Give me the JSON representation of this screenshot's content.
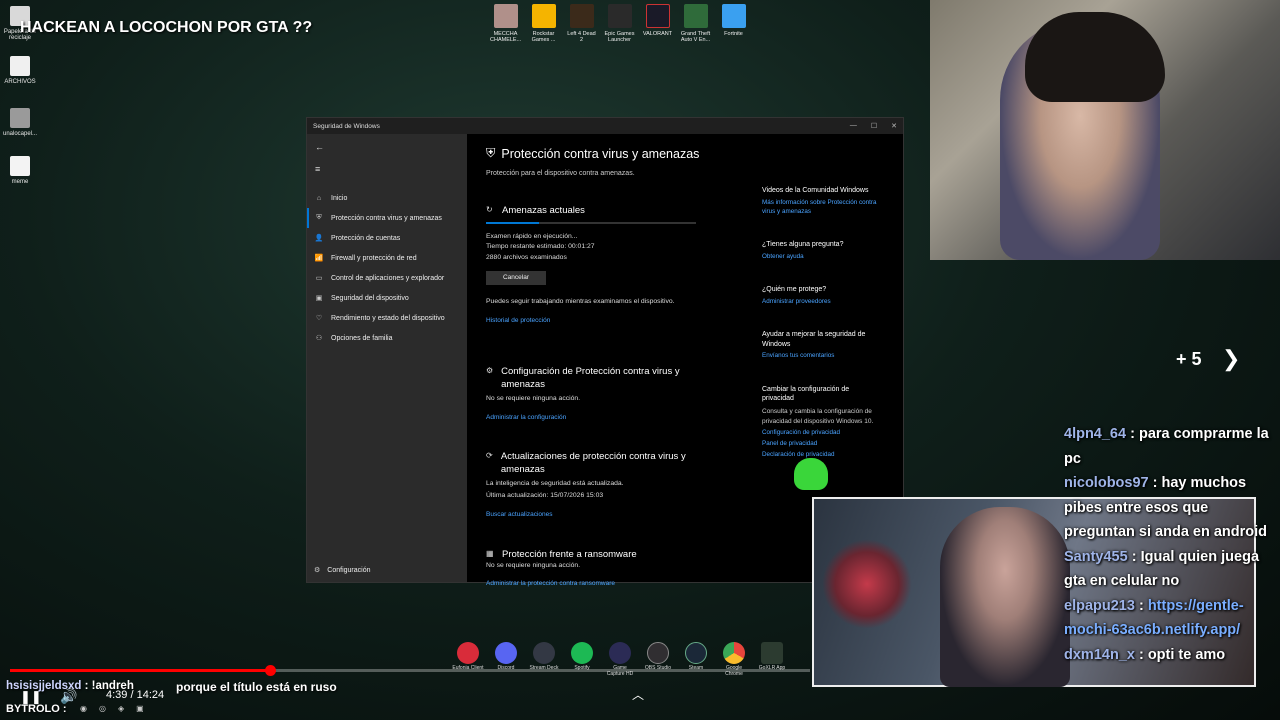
{
  "overlay": {
    "title": "HACKEAN A LOCOCHON POR GTA ??"
  },
  "desktop_icons": [
    {
      "label": "Papelera de reciclaje"
    },
    {
      "label": "ARCHIVOS"
    },
    {
      "label": "unalocapel..."
    },
    {
      "label": "meme"
    }
  ],
  "top_apps": [
    {
      "label": "MECCHA CHAMELE...",
      "color": "#b0908a"
    },
    {
      "label": "Rockstar Games ...",
      "color": "#f5b400"
    },
    {
      "label": "Left 4 Dead 2",
      "color": "#3b2a1a"
    },
    {
      "label": "Epic Games Launcher",
      "color": "#2a2a2a"
    },
    {
      "label": "VALORANT",
      "color": "#1a1a28"
    },
    {
      "label": "Grand Theft Auto V En...",
      "color": "#2f6b3a"
    },
    {
      "label": "Fortnite",
      "color": "#3aa0f0"
    }
  ],
  "window": {
    "title": "Seguridad de Windows",
    "controls": {
      "minimize": "—",
      "maximize": "☐",
      "close": "✕"
    },
    "sidebar": {
      "back": "←",
      "menu": "≡",
      "items": [
        {
          "icon": "⌂",
          "label": "Inicio"
        },
        {
          "icon": "⛨",
          "label": "Protección contra virus y amenazas"
        },
        {
          "icon": "👤",
          "label": "Protección de cuentas"
        },
        {
          "icon": "📶",
          "label": "Firewall y protección de red"
        },
        {
          "icon": "▭",
          "label": "Control de aplicaciones y explorador"
        },
        {
          "icon": "▣",
          "label": "Seguridad del dispositivo"
        },
        {
          "icon": "♡",
          "label": "Rendimiento y estado del dispositivo"
        },
        {
          "icon": "⚇",
          "label": "Opciones de familia"
        }
      ],
      "settings": {
        "icon": "⚙",
        "label": "Configuración"
      }
    },
    "main": {
      "header": "Protección contra virus y amenazas",
      "subtitle": "Protección para el dispositivo contra amenazas.",
      "current_threats": {
        "title": "Amenazas actuales",
        "progress": 0.25,
        "lines": [
          "Examen rápido en ejecución...",
          "Tiempo restante estimado: 00:01:27",
          "2880 archivos examinados"
        ],
        "cancel": "Cancelar",
        "note": "Puedes seguir trabajando mientras examinamos el dispositivo.",
        "link": "Historial de protección"
      },
      "settings_section": {
        "title": "Configuración de Protección contra virus y amenazas",
        "text": "No se requiere ninguna acción.",
        "link": "Administrar la configuración"
      },
      "updates_section": {
        "title": "Actualizaciones de protección contra virus y amenazas",
        "text1": "La inteligencia de seguridad está actualizada.",
        "text2": "Última actualización: 15/07/2026 15:03",
        "link": "Buscar actualizaciones"
      },
      "ransomware_section": {
        "title": "Protección frente a ransomware",
        "text": "No se requiere ninguna acción.",
        "link": "Administrar la protección contra ransomware"
      },
      "right": {
        "community": {
          "title": "Videos de la Comunidad Windows",
          "link": "Más información sobre Protección contra virus y amenazas"
        },
        "question": {
          "title": "¿Tienes alguna pregunta?",
          "link": "Obtener ayuda"
        },
        "who": {
          "title": "¿Quién me protege?",
          "link": "Administrar proveedores"
        },
        "improve": {
          "title": "Ayudar a mejorar la seguridad de Windows",
          "link": "Envíanos tus comentarios"
        },
        "privacy": {
          "title": "Cambiar la configuración de privacidad",
          "text": "Consulta y cambia la configuración de privacidad del dispositivo Windows 10.",
          "link1": "Configuración de privacidad",
          "link2": "Panel de privacidad",
          "link3": "Declaración de privacidad"
        }
      }
    }
  },
  "stream": {
    "plus_more": "+ 5",
    "chat": [
      {
        "user": "4lpn4_64",
        "sep": " : ",
        "msg": "para comprarme la pc"
      },
      {
        "user": "nicolobos97",
        "sep": " : ",
        "msg": "hay muchos pibes entre esos que preguntan si anda en android"
      },
      {
        "user": "Santy455",
        "sep": " : ",
        "msg": "Igual quien juega gta en celular no"
      },
      {
        "user": "elpapu213",
        "sep": " : ",
        "link": "https://gentle-mochi-63ac6b.netlify.app/"
      },
      {
        "user": "dxm14n_x",
        "sep": " : ",
        "msg": "opti te amo"
      }
    ],
    "bottom_chat": {
      "user": "hsisisjjeldsxd",
      "sep": " : ",
      "msg": "!andreh"
    },
    "bottom_chat2": "BYTROLO :",
    "bottom_msg": "porque el título está en ruso",
    "time": "4:39 / 14:24",
    "progress": 0.325
  },
  "dock": [
    {
      "label": "Eufonia Client",
      "color": "#d92c3a"
    },
    {
      "label": "Discord",
      "color": "#5865f2"
    },
    {
      "label": "Stream Deck",
      "color": "#333844"
    },
    {
      "label": "Spotify",
      "color": "#1db954"
    },
    {
      "label": "Game Capture HD",
      "color": "#2b2b55"
    },
    {
      "label": "OBS Studio",
      "color": "#302e31"
    },
    {
      "label": "Steam",
      "color": "#1b2838"
    },
    {
      "label": "Google Chrome",
      "color": "#e8453c"
    },
    {
      "label": "GoXLR App",
      "color": "#2c3b30"
    }
  ]
}
